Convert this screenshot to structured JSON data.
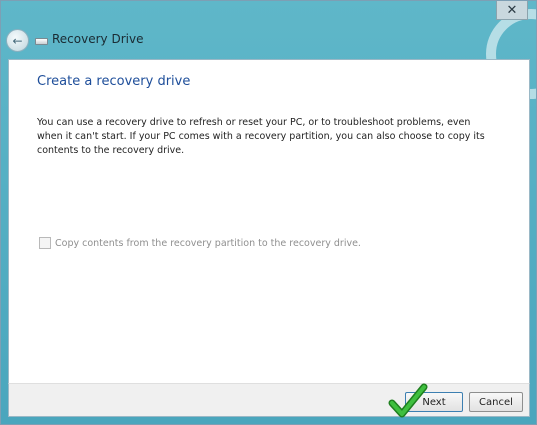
{
  "window": {
    "title": "Recovery Drive",
    "close_symbol": "✕"
  },
  "icons": {
    "back": "back-arrow-icon",
    "drive": "recovery-drive-icon",
    "check": "green-checkmark-icon"
  },
  "content": {
    "heading": "Create a recovery drive",
    "description": "You can use a recovery drive to refresh or reset your PC, or to troubleshoot problems, even when it can't start. If your PC comes with a recovery partition, you can also choose to copy its contents to the recovery drive.",
    "checkbox_label": "Copy contents from the recovery partition to the recovery drive.",
    "checkbox_checked": false,
    "checkbox_enabled": false
  },
  "buttons": {
    "next": "Next",
    "cancel": "Cancel"
  },
  "colors": {
    "heading": "#1e4e9a",
    "frame": "#56b0c4",
    "checkmark": "#2a9a2a"
  }
}
